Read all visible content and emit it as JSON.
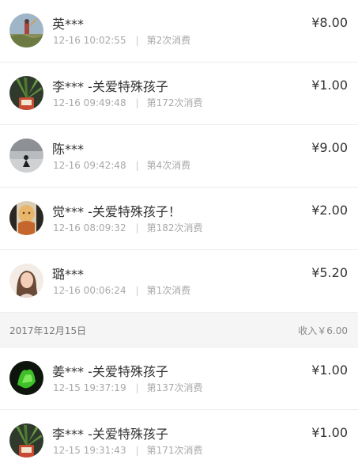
{
  "records_today": [
    {
      "name": "英***",
      "time": "12-16 10:02:55",
      "count": "第2次消费",
      "amount": "¥8.00",
      "avatar": "landscape-person-avatar"
    },
    {
      "name": "李*** -关爱特殊孩子",
      "time": "12-16 09:49:48",
      "count": "第172次消费",
      "amount": "¥1.00",
      "avatar": "plant-pot-avatar"
    },
    {
      "name": "陈***",
      "time": "12-16 09:42:48",
      "count": "第4次消费",
      "amount": "¥9.00",
      "avatar": "grey-scene-avatar"
    },
    {
      "name": "觉*** -关爱特殊孩子！",
      "time": "12-16 08:09:32",
      "count": "第182次消费",
      "amount": "¥2.00",
      "avatar": "statue-avatar"
    },
    {
      "name": "璐***",
      "time": "12-16 00:06:24",
      "count": "第1次消费",
      "amount": "¥5.20",
      "avatar": "woman-portrait-avatar"
    }
  ],
  "day_header": {
    "date": "2017年12月15日",
    "income": "收入￥6.00"
  },
  "records_prev": [
    {
      "name": "姜*** -关爱特殊孩子",
      "time": "12-15 19:37:19",
      "count": "第137次消费",
      "amount": "¥1.00",
      "avatar": "green-plant-avatar"
    },
    {
      "name": "李*** -关爱特殊孩子",
      "time": "12-15 19:31:43",
      "count": "第171次消费",
      "amount": "¥1.00",
      "avatar": "plant-pot-avatar"
    }
  ]
}
